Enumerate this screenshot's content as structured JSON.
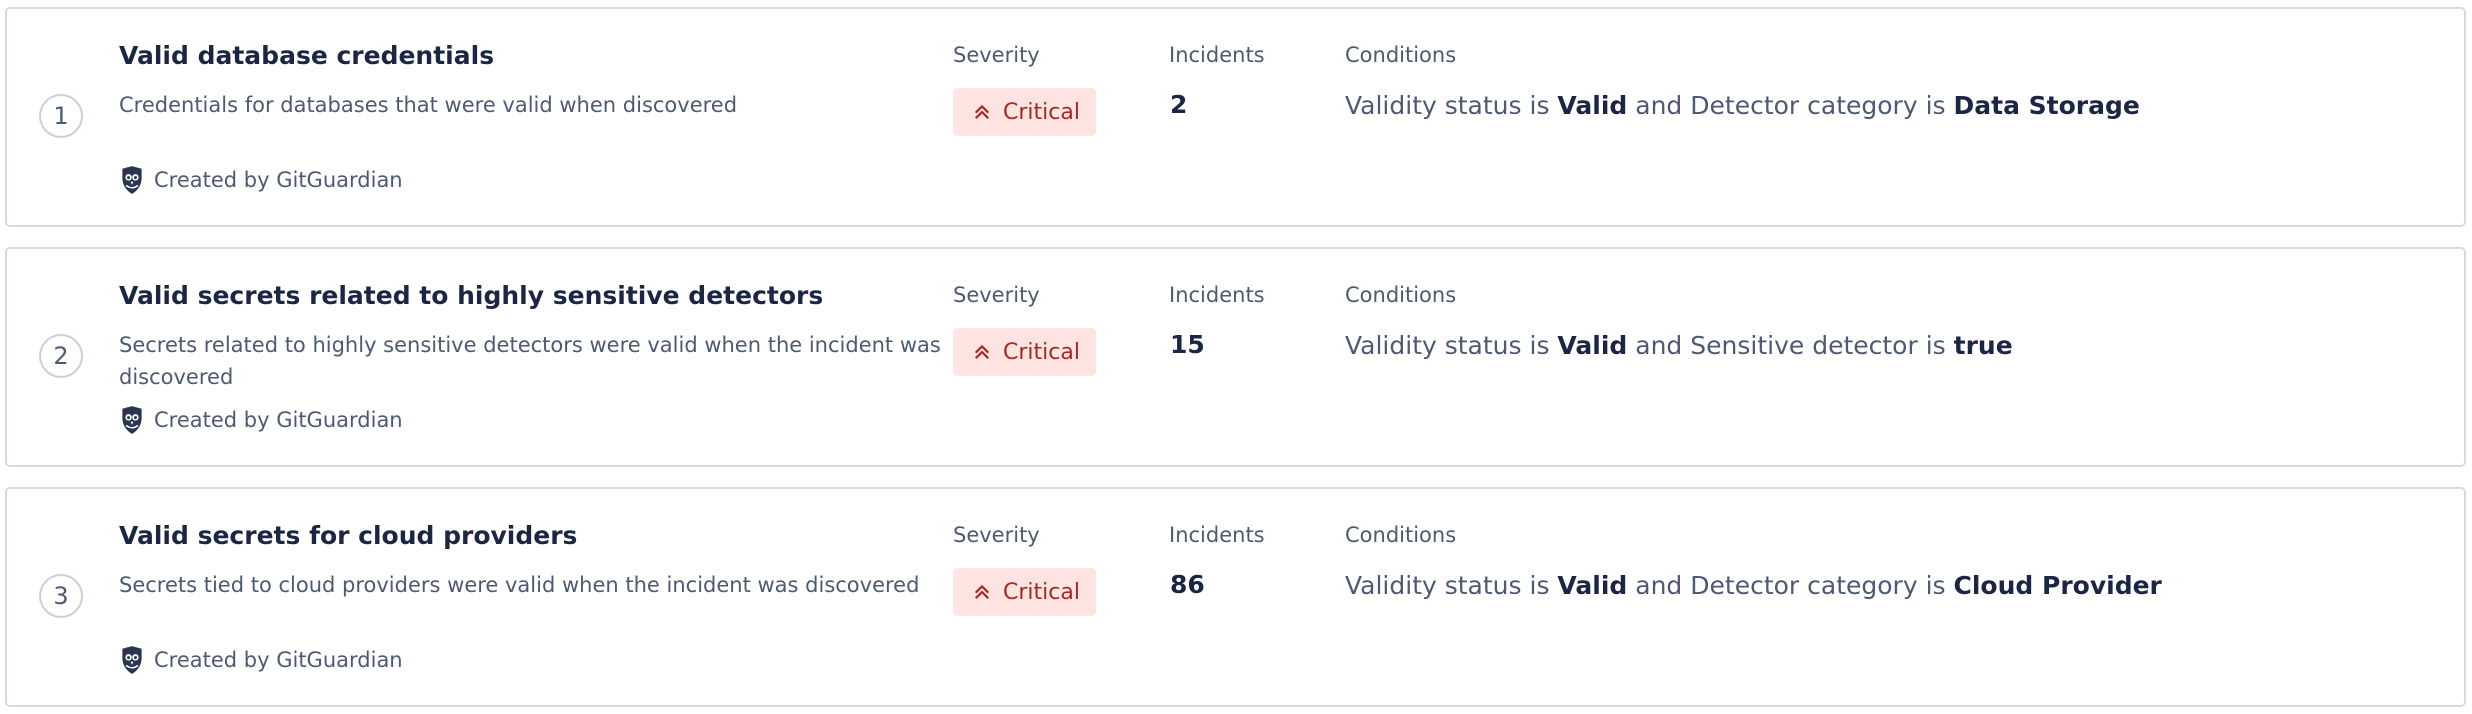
{
  "columns": {
    "severity": "Severity",
    "incidents": "Incidents",
    "conditions": "Conditions"
  },
  "colors": {
    "critical_bg": "#fde4e1",
    "critical_text": "#a52a23",
    "card_border": "#d6dae2",
    "heading": "#1b2645",
    "body_text": "#4e5a73"
  },
  "icons": {
    "creator": "gitguardian-owl-icon",
    "severity": "double-chevron-up-icon"
  },
  "rules": [
    {
      "rank": "1",
      "title": "Valid database credentials",
      "description": "Credentials for databases that were valid when discovered",
      "creator": "Created by GitGuardian",
      "severity": "Critical",
      "incidents": "2",
      "conditions": {
        "text_1": "Validity status is",
        "value_1": "Valid",
        "connector": "and",
        "text_2": "Detector category is",
        "value_2": "Data Storage"
      }
    },
    {
      "rank": "2",
      "title": "Valid secrets related to highly sensitive detectors",
      "description": "Secrets related to highly sensitive detectors were valid when the incident was discovered",
      "creator": "Created by GitGuardian",
      "severity": "Critical",
      "incidents": "15",
      "conditions": {
        "text_1": "Validity status is",
        "value_1": "Valid",
        "connector": "and",
        "text_2": "Sensitive detector is",
        "value_2": "true"
      }
    },
    {
      "rank": "3",
      "title": "Valid secrets for cloud providers",
      "description": "Secrets tied to cloud providers were valid when the incident was discovered",
      "creator": "Created by GitGuardian",
      "severity": "Critical",
      "incidents": "86",
      "conditions": {
        "text_1": "Validity status is",
        "value_1": "Valid",
        "connector": "and",
        "text_2": "Detector category is",
        "value_2": "Cloud Provider"
      }
    }
  ]
}
